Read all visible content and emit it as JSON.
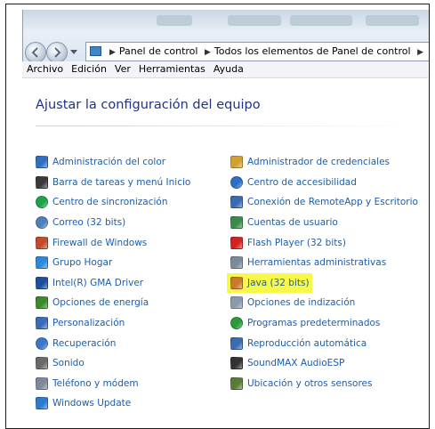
{
  "breadcrumb": [
    "Panel de control",
    "Todos los elementos de Panel de control"
  ],
  "menu": [
    "Archivo",
    "Edición",
    "Ver",
    "Herramientas",
    "Ayuda"
  ],
  "page_title": "Ajustar la configuración del equipo",
  "left_items": [
    {
      "label": "Administración del color",
      "icon": "color-management-icon",
      "color": "#2f6fc2"
    },
    {
      "label": "Barra de tareas y menú Inicio",
      "icon": "taskbar-icon",
      "color": "#3a3a3a"
    },
    {
      "label": "Centro de sincronización",
      "icon": "sync-center-icon",
      "color": "#1fa34a"
    },
    {
      "label": "Correo (32 bits)",
      "icon": "mail-icon",
      "color": "#4d7fb8"
    },
    {
      "label": "Firewall de Windows",
      "icon": "firewall-icon",
      "color": "#c44a2a"
    },
    {
      "label": "Grupo Hogar",
      "icon": "homegroup-icon",
      "color": "#2a8ad8"
    },
    {
      "label": "Intel(R) GMA Driver",
      "icon": "intel-driver-icon",
      "color": "#1d4f9a"
    },
    {
      "label": "Opciones de energía",
      "icon": "power-options-icon",
      "color": "#3a8a2a"
    },
    {
      "label": "Personalización",
      "icon": "personalization-icon",
      "color": "#3b6bb8"
    },
    {
      "label": "Recuperación",
      "icon": "recovery-icon",
      "color": "#3b78c8"
    },
    {
      "label": "Sonido",
      "icon": "speaker-icon",
      "color": "#6a6a6a"
    },
    {
      "label": "Teléfono y módem",
      "icon": "phone-modem-icon",
      "color": "#7a8a9a"
    },
    {
      "label": "Windows Update",
      "icon": "windows-update-icon",
      "color": "#2a7ad0"
    }
  ],
  "right_items": [
    {
      "label": "Administrador de credenciales",
      "icon": "credential-manager-icon",
      "color": "#d0a030"
    },
    {
      "label": "Centro de accesibilidad",
      "icon": "accessibility-icon",
      "color": "#2a6fc8"
    },
    {
      "label": "Conexión de RemoteApp y Escritorio",
      "icon": "remoteapp-icon",
      "color": "#3a6ab0"
    },
    {
      "label": "Cuentas de usuario",
      "icon": "user-accounts-icon",
      "color": "#3a8a4a"
    },
    {
      "label": "Flash Player (32 bits)",
      "icon": "flash-player-icon",
      "color": "#d4231e"
    },
    {
      "label": "Herramientas administrativas",
      "icon": "admin-tools-icon",
      "color": "#7a8a9a"
    },
    {
      "label": "Java (32 bits)",
      "icon": "java-icon",
      "color": "#c87a2a",
      "highlighted": true
    },
    {
      "label": "Opciones de indización",
      "icon": "indexing-icon",
      "color": "#8a9aaa"
    },
    {
      "label": "Programas predeterminados",
      "icon": "default-programs-icon",
      "color": "#2a9a3a"
    },
    {
      "label": "Reproducción automática",
      "icon": "autoplay-icon",
      "color": "#3a6ab0"
    },
    {
      "label": "SoundMAX AudioESP",
      "icon": "soundmax-icon",
      "color": "#333333"
    },
    {
      "label": "Ubicación y otros sensores",
      "icon": "location-sensors-icon",
      "color": "#5a7a3a"
    }
  ],
  "highlight_color": "#f7f94a",
  "link_color": "#1f5da8"
}
